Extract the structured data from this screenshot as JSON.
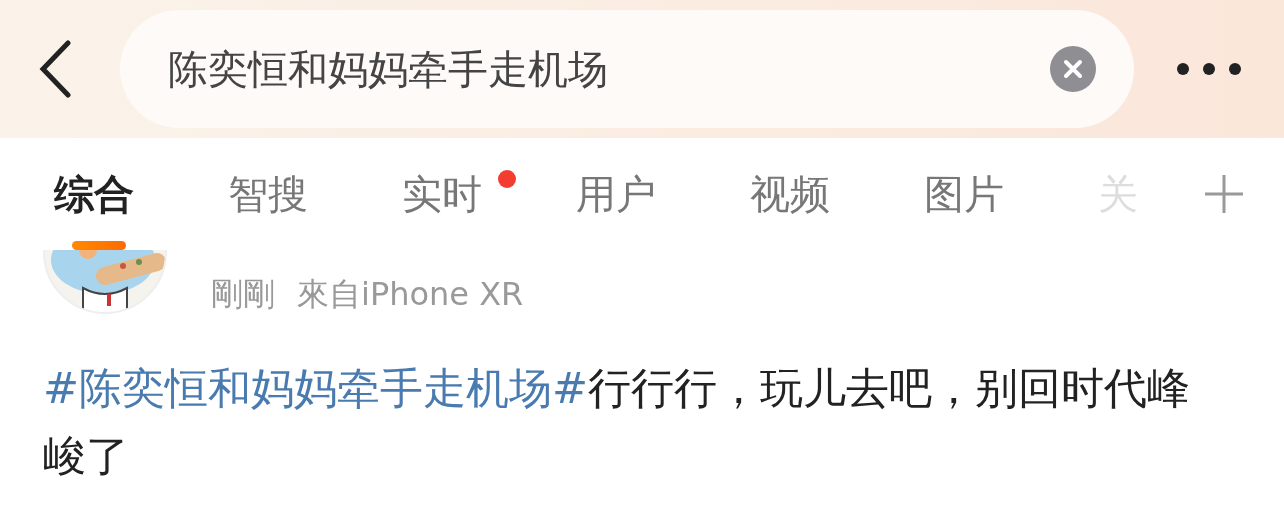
{
  "search": {
    "value": "陈奕恒和妈妈牵手走机场"
  },
  "tabs": [
    {
      "label": "综合",
      "selected": true,
      "dot": false
    },
    {
      "label": "智搜",
      "selected": false,
      "dot": false
    },
    {
      "label": "实时",
      "selected": false,
      "dot": true
    },
    {
      "label": "用户",
      "selected": false,
      "dot": false
    },
    {
      "label": "视频",
      "selected": false,
      "dot": false
    },
    {
      "label": "图片",
      "selected": false,
      "dot": false
    },
    {
      "label": "关",
      "selected": false,
      "dot": false
    }
  ],
  "post": {
    "time": "剛剛",
    "source": "來自iPhone XR",
    "hashtag": "#陈奕恒和妈妈牵手走机场#",
    "text": "行行行，玩儿去吧，别回时代峰峻了"
  }
}
